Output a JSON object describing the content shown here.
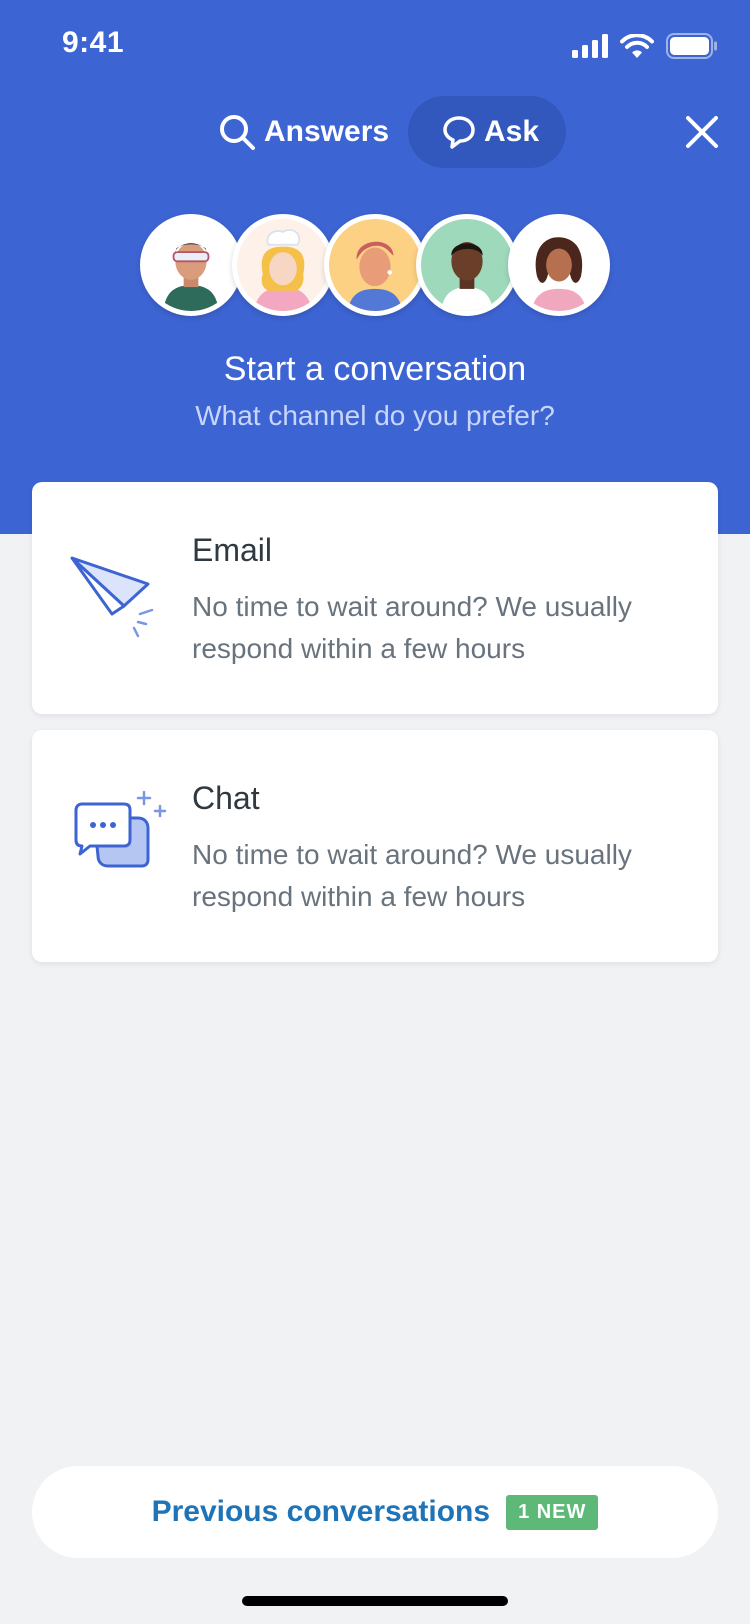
{
  "status_bar": {
    "time": "9:41",
    "icons": [
      "signal-icon",
      "wifi-icon",
      "battery-icon"
    ]
  },
  "nav": {
    "tabs": [
      {
        "label": "Answers",
        "icon": "search-icon",
        "active": false
      },
      {
        "label": "Ask",
        "icon": "chat-bubble-icon",
        "active": true
      }
    ],
    "close_icon": "close-icon"
  },
  "hero": {
    "title": "Start a conversation",
    "subtitle": "What channel do you prefer?",
    "avatars": [
      "avatar-1",
      "avatar-2",
      "avatar-3",
      "avatar-4",
      "avatar-5"
    ]
  },
  "channels": [
    {
      "title": "Email",
      "description": "No time to wait around? We usually respond within a few hours",
      "icon": "paper-plane-icon"
    },
    {
      "title": "Chat",
      "description": "No time to wait around? We usually respond within a few hours",
      "icon": "chat-bubbles-icon"
    }
  ],
  "previous": {
    "label": "Previous conversations",
    "badge": "1 NEW"
  },
  "colors": {
    "brand": "#3d64d3",
    "active_tab": "#3257bd",
    "link": "#1f73b7",
    "badge": "#5eb978",
    "background": "#f1f2f4"
  }
}
